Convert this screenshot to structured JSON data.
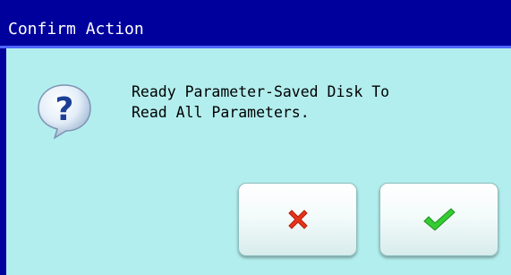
{
  "dialog": {
    "title": "Confirm Action",
    "message_lines": [
      "Ready Parameter-Saved Disk To",
      "Read All Parameters."
    ],
    "icon": "question-icon"
  },
  "buttons": {
    "cancel_icon": "x-icon",
    "ok_icon": "checkmark-icon"
  },
  "colors": {
    "titlebar": "#00009c",
    "panel": "#b3eeee",
    "cancel_icon": "#e8331a",
    "ok_icon": "#33cc33"
  }
}
